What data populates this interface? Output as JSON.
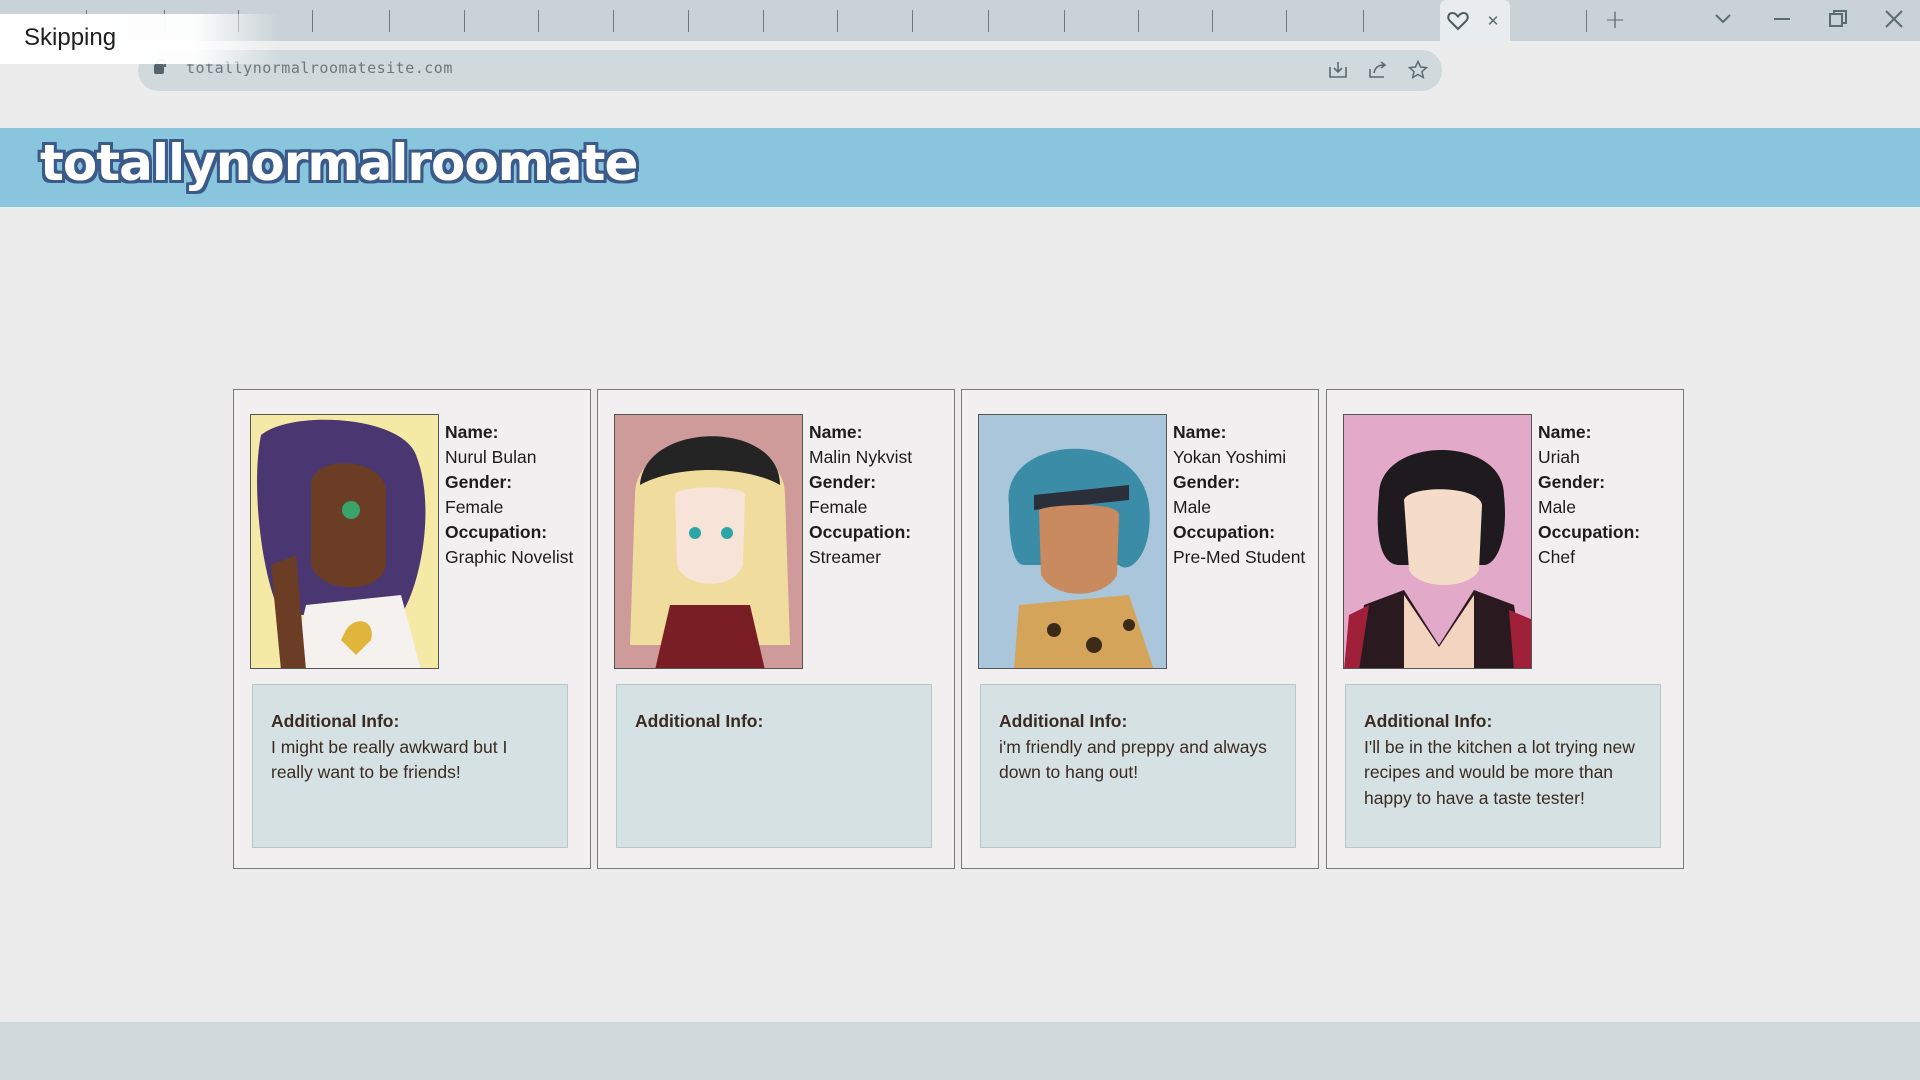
{
  "overlay": {
    "status": "Skipping"
  },
  "browser": {
    "url": "totallynormalroomatesite.com",
    "icons": [
      "lock-icon",
      "install-icon",
      "share-icon",
      "star-icon",
      "heart-icon",
      "close-tab-icon",
      "new-tab-icon",
      "chevron-down-icon",
      "minimize-icon",
      "restore-icon",
      "close-window-icon"
    ]
  },
  "site": {
    "logo_text": "totallynormalroomate"
  },
  "labels": {
    "name": "Name:",
    "gender": "Gender:",
    "occupation": "Occupation:",
    "additional": "Additional Info:"
  },
  "profiles": [
    {
      "name": "Nurul Bulan",
      "gender": "Female",
      "occupation": "Graphic Novelist",
      "additional": "I might be really awkward but I really want to be friends!",
      "portrait_bg": "#f5e9a6"
    },
    {
      "name": "Malin Nykvist",
      "gender": "Female",
      "occupation": "Streamer",
      "additional": "",
      "portrait_bg": "#cf9a9a"
    },
    {
      "name": "Yokan Yoshimi",
      "gender": "Male",
      "occupation": "Pre-Med Student",
      "additional": "i'm friendly and preppy and always down to hang out!",
      "portrait_bg": "#a9c6da"
    },
    {
      "name": "Uriah",
      "gender": "Male",
      "occupation": "Chef",
      "additional": "I'll be in the kitchen a lot trying new recipes and would be more than happy to have a taste tester!",
      "portrait_bg": "#e3a9c9"
    }
  ]
}
